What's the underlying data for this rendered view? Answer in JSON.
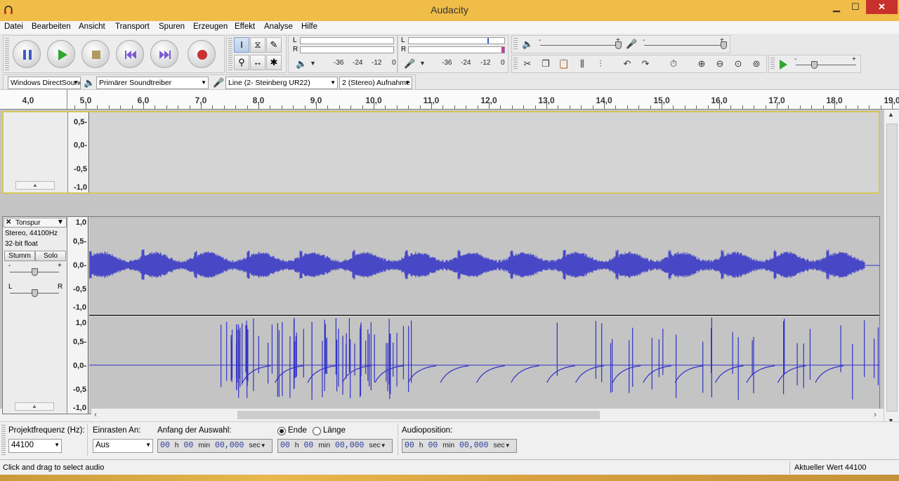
{
  "window": {
    "title": "Audacity",
    "minimize": "▁",
    "maximize": "☐",
    "close": "✕"
  },
  "menu": [
    "Datei",
    "Bearbeiten",
    "Ansicht",
    "Transport",
    "Spuren",
    "Erzeugen",
    "Effekt",
    "Analyse",
    "Hilfe"
  ],
  "meters": {
    "playback_channels": [
      "L",
      "R"
    ],
    "record_channels": [
      "L",
      "R"
    ],
    "ticks": [
      "-36",
      "-24",
      "-12",
      "0"
    ]
  },
  "mixer": {
    "min": "-",
    "max": "+"
  },
  "play_speed": {
    "min": "-",
    "max": "+"
  },
  "devices": {
    "host": "Windows DirectSound",
    "output": "Primärer Soundtreiber",
    "input": "Line (2- Steinberg UR22)",
    "channels": "2 (Stereo) Aufnahme"
  },
  "ruler": [
    "4,0",
    "5,0",
    "6,0",
    "7,0",
    "8,0",
    "9,0",
    "10,0",
    "11,0",
    "12,0",
    "13,0",
    "14,0",
    "15,0",
    "16,0",
    "17,0",
    "18,0",
    "19,0"
  ],
  "track1": {
    "scale": [
      "0,5-",
      "0,0-",
      "-0,5",
      "-1,0"
    ]
  },
  "track2": {
    "name": "Tonspur",
    "info1": "Stereo, 44100Hz",
    "info2": "32-bit float",
    "mute": "Stumm",
    "solo": "Solo",
    "gain_min": "-",
    "gain_max": "+",
    "pan_left": "L",
    "pan_right": "R",
    "scale_top": [
      "1,0",
      "0,5-",
      "0,0-",
      "-0,5",
      "-1,0"
    ],
    "scale_bottom": [
      "1,0",
      "0,5-",
      "0,0-",
      "-0,5",
      "-1,0"
    ],
    "close": "✕"
  },
  "selection": {
    "rate_label": "Projektfrequenz (Hz):",
    "rate_value": "44100",
    "snap_label": "Einrasten An:",
    "snap_value": "Aus",
    "start_label": "Anfang der Auswahl:",
    "end_label": "Ende",
    "length_label": "Länge",
    "audio_pos_label": "Audioposition:",
    "time1": {
      "h": "00",
      "m": "00",
      "s": "00,000"
    },
    "time2": {
      "h": "00",
      "m": "00",
      "s": "00,000"
    },
    "time3": {
      "h": "00",
      "m": "00",
      "s": "00,000"
    },
    "u_h": "h",
    "u_min": "min",
    "u_sec": "sec"
  },
  "status": {
    "left": "Click and drag to select audio",
    "right": "Aktueller Wert 44100"
  },
  "colors": {
    "wave": "#3232c8",
    "track_bg": "#e4e4e4",
    "titlebar": "#f0bd48",
    "close": "#c7302b"
  }
}
